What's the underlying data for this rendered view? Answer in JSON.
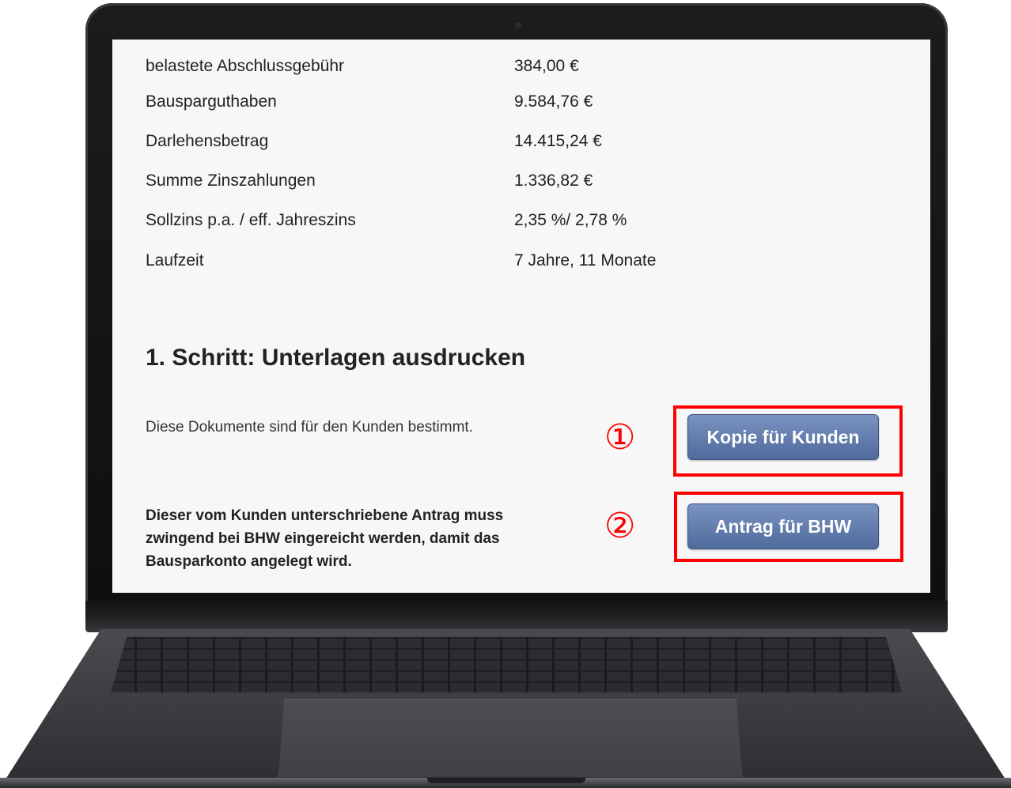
{
  "summary_rows": [
    {
      "label": "belastete Abschlussgebühr",
      "value": "384,00 €"
    },
    {
      "label": "Bausparguthaben",
      "value": "9.584,76 €"
    },
    {
      "label": "Darlehensbetrag",
      "value": "14.415,24 €"
    },
    {
      "label": "Summe Zinszahlungen",
      "value": "1.336,82 €"
    },
    {
      "label": "Sollzins p.a. / eff. Jahreszins",
      "value": "2,35 %/ 2,78 %"
    },
    {
      "label": "Laufzeit",
      "value": "7 Jahre, 11 Monate"
    }
  ],
  "step": {
    "heading": "1. Schritt: Unterlagen ausdrucken",
    "customer_text": "Diese Dokumente sind für den Kunden bestimmt.",
    "customer_button": "Kopie für Kunden",
    "bhw_text_lines": [
      "Dieser vom Kunden unterschriebene Antrag muss",
      "zwingend bei BHW eingereicht werden, damit das",
      "Bausparkonto angelegt wird."
    ],
    "bhw_button": "Antrag für BHW"
  },
  "annotations": {
    "marker_1": "①",
    "marker_2": "②",
    "highlight_color": "#ff0000"
  },
  "colors": {
    "button_top": "#7a93c0",
    "button_bottom": "#4f6a9c",
    "screen_bg": "#f7f7f7"
  }
}
